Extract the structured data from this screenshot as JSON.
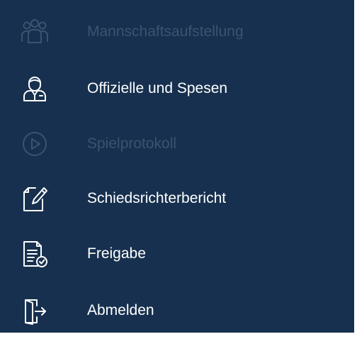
{
  "menu": {
    "items": [
      {
        "label": "Mannschaftsaufstellung",
        "icon": "team-icon",
        "enabled": false
      },
      {
        "label": "Offizielle und Spesen",
        "icon": "official-person-icon",
        "enabled": true
      },
      {
        "label": "Spielprotokoll",
        "icon": "play-circle-icon",
        "enabled": false
      },
      {
        "label": "Schiedsrichterbericht",
        "icon": "edit-document-icon",
        "enabled": true
      },
      {
        "label": "Freigabe",
        "icon": "document-check-icon",
        "enabled": true
      },
      {
        "label": "Abmelden",
        "icon": "logout-door-icon",
        "enabled": true
      }
    ]
  },
  "colors": {
    "background": "#17304f",
    "enabled_text": "#ffffff",
    "disabled_text": "#3c5370"
  }
}
